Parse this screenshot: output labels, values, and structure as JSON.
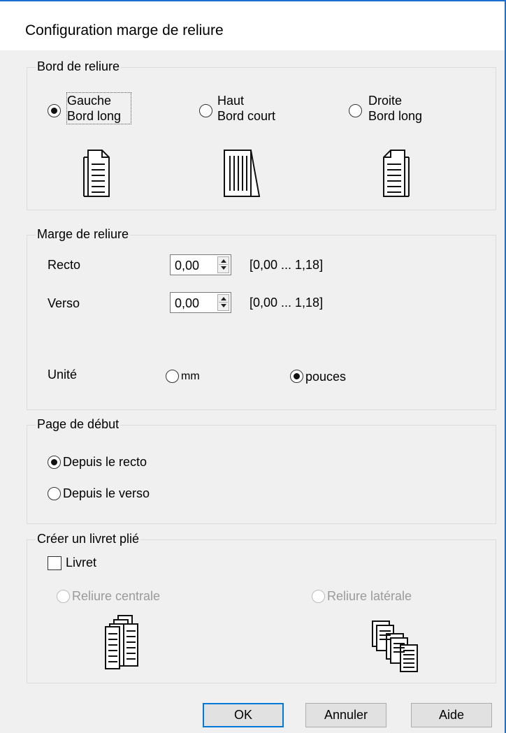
{
  "window": {
    "title": "Configuration marge de reliure"
  },
  "binding_edge": {
    "legend": "Bord de reliure",
    "options": [
      {
        "line1": "Gauche",
        "line2": "Bord long",
        "checked": true,
        "icon": "left-binding-page-icon"
      },
      {
        "line1": "Haut",
        "line2": "Bord court",
        "checked": false,
        "icon": "top-binding-page-icon"
      },
      {
        "line1": "Droite",
        "line2": "Bord long",
        "checked": false,
        "icon": "right-binding-page-icon"
      }
    ]
  },
  "binding_margin": {
    "legend": "Marge de reliure",
    "recto": {
      "label": "Recto",
      "value": "0,00",
      "range": "[0,00 ... 1,18]"
    },
    "verso": {
      "label": "Verso",
      "value": "0,00",
      "range": "[0,00 ... 1,18]"
    },
    "unit": {
      "label": "Unité",
      "options": [
        {
          "label": "mm",
          "checked": false
        },
        {
          "label": "pouces",
          "checked": true
        }
      ]
    }
  },
  "start_page": {
    "legend": "Page de début",
    "options": [
      {
        "label": "Depuis le recto",
        "checked": true
      },
      {
        "label": "Depuis le verso",
        "checked": false
      }
    ]
  },
  "booklet": {
    "legend": "Créer un livret plié",
    "checkbox_label": "Livret",
    "checked": false,
    "options": [
      {
        "label": "Reliure centrale",
        "enabled": false,
        "icon": "center-binding-booklet-icon"
      },
      {
        "label": "Reliure latérale",
        "enabled": false,
        "icon": "side-binding-booklet-icon"
      }
    ]
  },
  "buttons": {
    "ok": "OK",
    "cancel": "Annuler",
    "help": "Aide"
  }
}
